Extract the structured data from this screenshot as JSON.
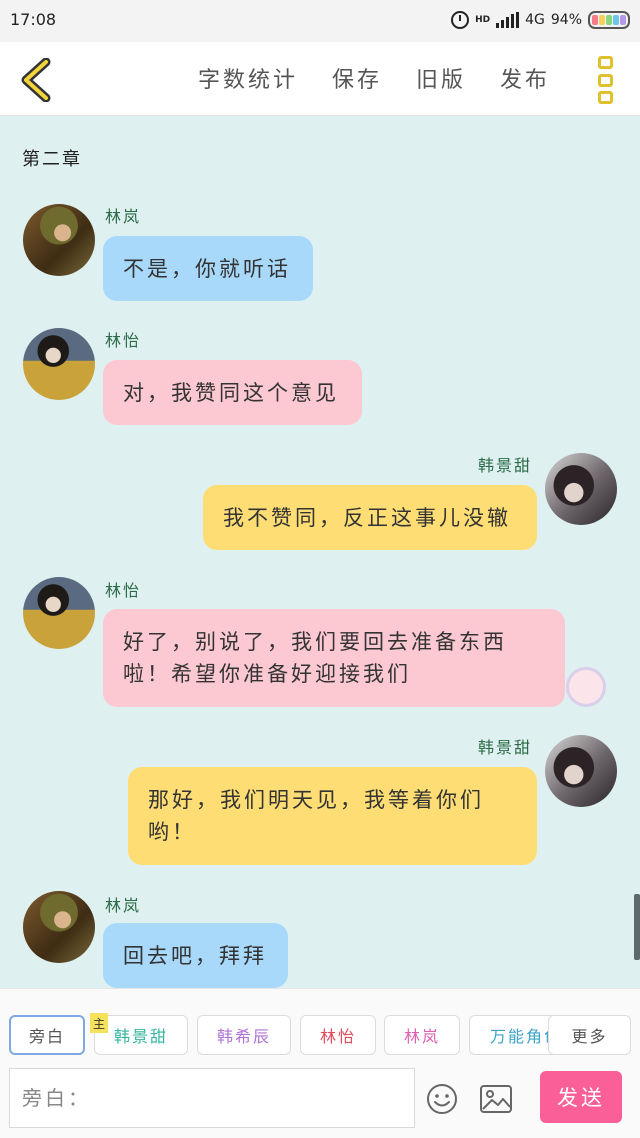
{
  "status": {
    "time": "17:08",
    "hd": "HD",
    "network": "4G",
    "battery": "94%"
  },
  "header": {
    "actions": [
      "字数统计",
      "保存",
      "旧版",
      "发布"
    ]
  },
  "chat": {
    "chapter": "第二章",
    "messages": [
      {
        "speaker": "林岚",
        "text": "不是，你就听话",
        "side": "left",
        "color": "blue"
      },
      {
        "speaker": "林怡",
        "text": "对，我赞同这个意见",
        "side": "left",
        "color": "pink"
      },
      {
        "speaker": "韩景甜",
        "text": "我不赞同，反正这事儿没辙",
        "side": "right",
        "color": "yellow"
      },
      {
        "speaker": "林怡",
        "text": "好了，别说了，我们要回去准备东西啦！希望你准备好迎接我们",
        "side": "left",
        "color": "pink"
      },
      {
        "speaker": "韩景甜",
        "text": "那好，我们明天见，我等着你们哟！",
        "side": "right",
        "color": "yellow"
      },
      {
        "speaker": "林岚",
        "text": "回去吧，拜拜",
        "side": "left",
        "color": "blue"
      }
    ]
  },
  "colors": {
    "blue_bubble": "#a8d9fb",
    "pink_bubble": "#fcc9d3",
    "yellow_bubble": "#fedd74",
    "send_button": "#fb5f98",
    "name_green": "#2b6b48"
  },
  "roles": [
    {
      "label": "旁白",
      "color": "#555555"
    },
    {
      "label": "韩景甜",
      "color": "#33b5a0"
    },
    {
      "label": "韩希辰",
      "color": "#b073d4"
    },
    {
      "label": "林怡",
      "color": "#e04a5c"
    },
    {
      "label": "林岚",
      "color": "#e05fb0"
    },
    {
      "label": "万能角色",
      "color": "#3aa3c9"
    }
  ],
  "main_tag": "主",
  "more_label": "更多",
  "input": {
    "placeholder": "旁白："
  },
  "send_label": "发送"
}
